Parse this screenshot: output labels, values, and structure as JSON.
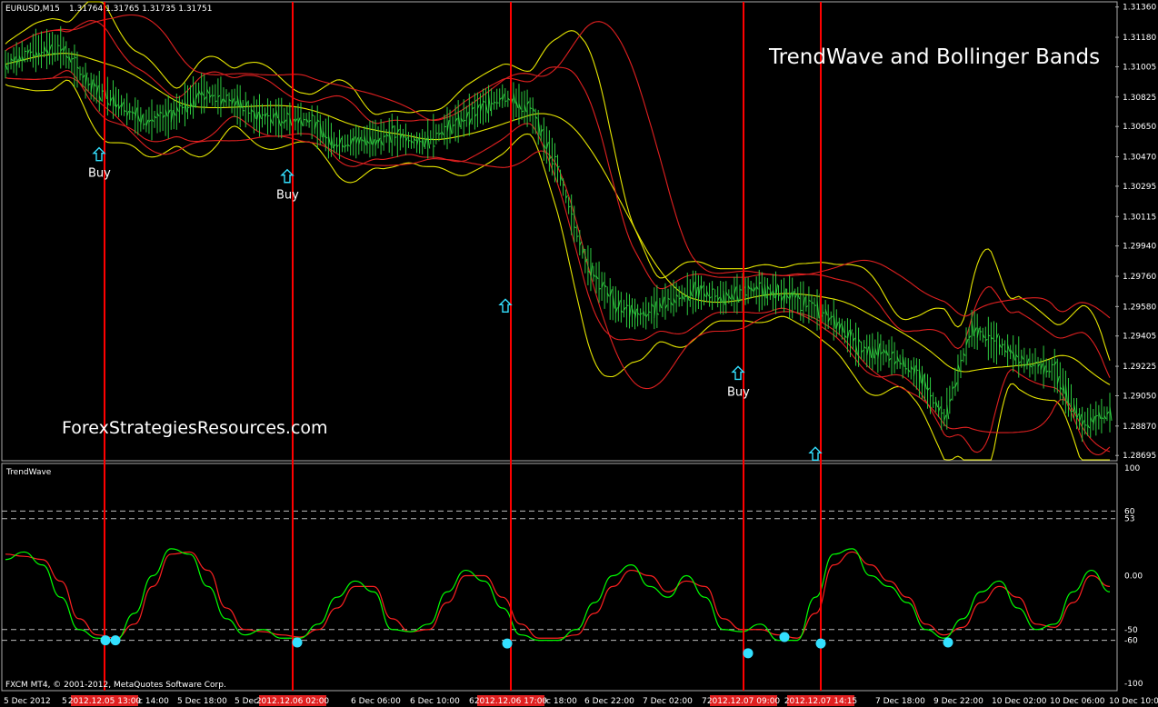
{
  "window": {
    "symbol_label": "EURUSD,M15",
    "ohlc": "1.31764 1.31765 1.31735 1.31751",
    "title_overlay": "TrendWave and Bollinger Bands",
    "watermark": "ForexStrategiesResources.com",
    "indicator_name": "TrendWave",
    "copyright": "FXCM MT4, © 2001-2012, MetaQuotes Software Corp."
  },
  "colors": {
    "background": "#000000",
    "candle": "#2ecc40",
    "band_yellow": "#e6e600",
    "band_red": "#e02020",
    "vline": "#ff0000",
    "signal": "#33e0ff",
    "wave_green": "#00ff00",
    "wave_red": "#ff2020",
    "axis_text": "#ffffff"
  },
  "price_axis": {
    "min": 1.2868,
    "max": 1.3138,
    "labels": [
      "1.31360",
      "1.31180",
      "1.31005",
      "1.30825",
      "1.30650",
      "1.30470",
      "1.30295",
      "1.30115",
      "1.29940",
      "1.29760",
      "1.29580",
      "1.29405",
      "1.29225",
      "1.29050",
      "1.28870",
      "1.28695"
    ]
  },
  "osc_axis": {
    "min": -100,
    "max": 100,
    "labels": [
      "100",
      "60",
      "53",
      "0.00",
      "-50",
      "-60",
      "-100"
    ],
    "levels": [
      60,
      53,
      -50,
      -60
    ]
  },
  "time_axis": {
    "labels": [
      "5 Dec 2012",
      "5",
      "5 Dec 14:00",
      "5 Dec 18:00",
      "5 Dec 22:00",
      "6 Dec 06:00",
      "6 Dec 10:00",
      "6",
      "6 Dec 18:00",
      "6 Dec 22:00",
      "7 Dec 02:00",
      "7",
      "7 Dec 18:00",
      "9 Dec 22:00",
      "10 Dec 02:00",
      "10 Dec 06:00",
      "10 Dec 10:00"
    ],
    "highlighted": [
      "2012.12.05 13:00",
      "2012.12.06 02:00",
      "2012.12.06 17:00",
      "2012.12.07 09:00",
      "2012.12.07 14:15"
    ]
  },
  "chart_data": {
    "type": "line",
    "title": "TrendWave and Bollinger Bands",
    "price_series": {
      "name": "EURUSD",
      "x": [
        0,
        10,
        20,
        30,
        40,
        50,
        60,
        70,
        80,
        90,
        100,
        110,
        120,
        130,
        140,
        150,
        160,
        170,
        180,
        190,
        200,
        210,
        220,
        230,
        240,
        250,
        260,
        270,
        280,
        290,
        300,
        310,
        320,
        330,
        340,
        350,
        360,
        370,
        380,
        390,
        400
      ],
      "y": [
        1.3102,
        1.311,
        1.3112,
        1.309,
        1.308,
        1.3068,
        1.3071,
        1.3085,
        1.3082,
        1.3072,
        1.307,
        1.3069,
        1.3054,
        1.3057,
        1.306,
        1.3055,
        1.3064,
        1.3074,
        1.3083,
        1.3075,
        1.304,
        1.2985,
        1.296,
        1.2952,
        1.2962,
        1.2967,
        1.2963,
        1.2968,
        1.2966,
        1.296,
        1.295,
        1.2932,
        1.293,
        1.2918,
        1.2892,
        1.2945,
        1.2935,
        1.2925,
        1.292,
        1.2888,
        1.2895
      ]
    },
    "buy_signals": [
      {
        "label": "Buy",
        "price": 1.3048
      },
      {
        "label": "Buy",
        "price": 1.3035
      },
      {
        "label": "",
        "price": 1.2958
      },
      {
        "label": "Buy",
        "price": 1.2918
      },
      {
        "label": "",
        "price": 1.287
      }
    ],
    "trendwave": {
      "green": [
        15,
        22,
        10,
        -20,
        -50,
        -58,
        -60,
        -35,
        0,
        25,
        20,
        -10,
        -40,
        -55,
        -50,
        -58,
        -58,
        -45,
        -20,
        -5,
        -15,
        -50,
        -52,
        -45,
        -15,
        5,
        -5,
        -30,
        -55,
        -60,
        -60,
        -50,
        -25,
        0,
        10,
        -10,
        -20,
        0,
        -20,
        -50,
        -52,
        -45,
        -60,
        -60,
        -20,
        20,
        25,
        0,
        -10,
        -25,
        -50,
        -58,
        -40,
        -15,
        -5,
        -30,
        -50,
        -45,
        -15,
        5,
        -15
      ],
      "red": [
        20,
        18,
        15,
        -5,
        -40,
        -55,
        -58,
        -45,
        -10,
        20,
        22,
        5,
        -30,
        -50,
        -52,
        -55,
        -57,
        -50,
        -30,
        -10,
        -10,
        -40,
        -52,
        -50,
        -25,
        0,
        0,
        -20,
        -45,
        -58,
        -58,
        -55,
        -35,
        -10,
        5,
        0,
        -15,
        -5,
        -10,
        -40,
        -50,
        -50,
        -55,
        -58,
        -35,
        10,
        22,
        10,
        -5,
        -20,
        -45,
        -55,
        -48,
        -25,
        -10,
        -20,
        -45,
        -48,
        -25,
        0,
        -10
      ],
      "signal_dots": [
        -60,
        -60,
        -62,
        -63,
        -72,
        -57,
        -63,
        -62
      ]
    }
  }
}
